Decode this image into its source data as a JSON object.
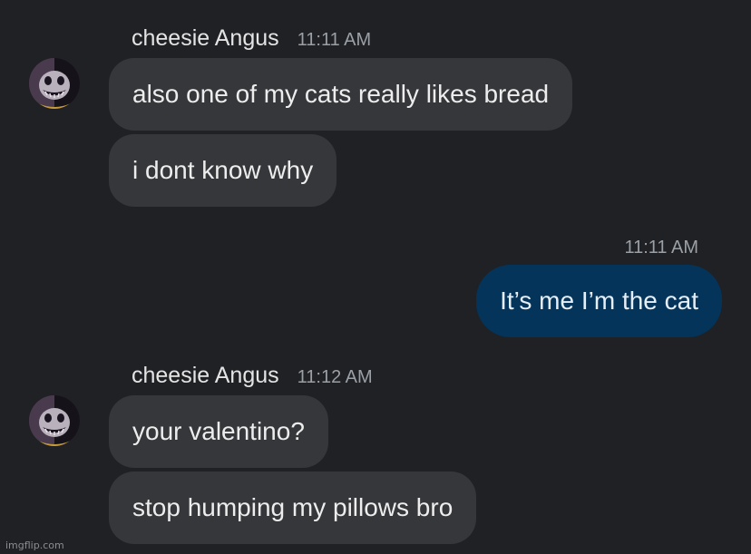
{
  "thread": {
    "groups": [
      {
        "sender": "cheesie Angus",
        "time": "11:11 AM",
        "messages": [
          "also one of my cats really likes bread",
          "i dont know why"
        ]
      },
      {
        "outgoing_time": "11:11 AM",
        "outgoing_message": "It’s me I’m the cat"
      },
      {
        "sender": "cheesie Angus",
        "time": "11:12 AM",
        "messages": [
          "your valentino?",
          "stop humping my pillows bro"
        ]
      }
    ]
  },
  "colors": {
    "background": "#202124",
    "incoming_bubble": "#36373a",
    "outgoing_bubble": "#04345a",
    "timestamp": "#9aa0a6"
  },
  "icons": {
    "avatar": "cartoon-skull-grin-avatar"
  },
  "watermark": "imgflip.com"
}
